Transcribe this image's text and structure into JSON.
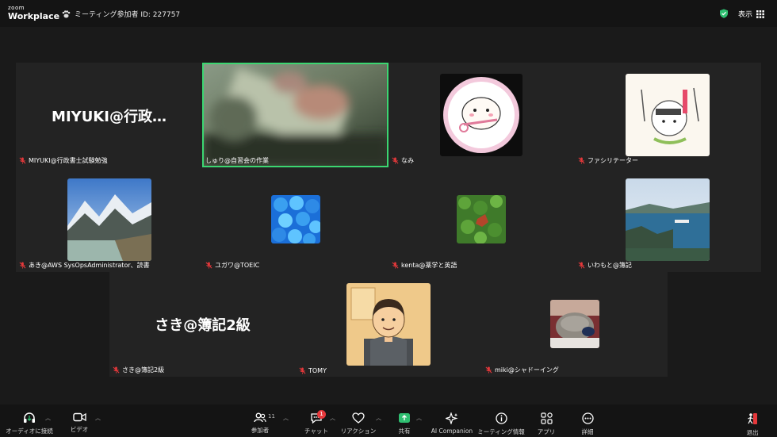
{
  "app": {
    "logo_line1": "zoom",
    "logo_line2": "Workplace"
  },
  "header": {
    "meeting_id": "ミーティング参加者 ID: 227757",
    "view_label": "表示"
  },
  "participants": {
    "miyuki": {
      "display": "MIYUKI@行政…",
      "label": "MIYUKI@行政書士試験勉強"
    },
    "shuri": {
      "label": "しゅり@自習会の作業"
    },
    "nami": {
      "label": "なみ"
    },
    "facilitator": {
      "label": "ファシリテーター"
    },
    "aki": {
      "label": "あき@AWS SysOpsAdministrator、読書"
    },
    "yugawa": {
      "label": "ユガワ@TOEIC"
    },
    "kenta": {
      "label": "kenta@薬学と英語"
    },
    "iwamoto": {
      "label": "いわもと@簿記"
    },
    "saki": {
      "display": "さき@簿記2級",
      "label": "さき@簿記2級"
    },
    "tomy": {
      "label": "TOMY"
    },
    "miki": {
      "label": "miki@シャドーイング"
    }
  },
  "toolbar": {
    "audio": "オーディオに接続",
    "video": "ビデオ",
    "participants": "参加者",
    "participants_count": "11",
    "chat": "チャット",
    "chat_badge": "1",
    "reaction": "リアクション",
    "share": "共有",
    "ai": "AI Companion",
    "info": "ミーティング情報",
    "apps": "アプリ",
    "more": "詳細",
    "leave": "退出"
  },
  "colors": {
    "active_speaker": "#3bd671",
    "share": "#2fbf71",
    "leave": "#e5383b",
    "badge": "#e5383b"
  }
}
